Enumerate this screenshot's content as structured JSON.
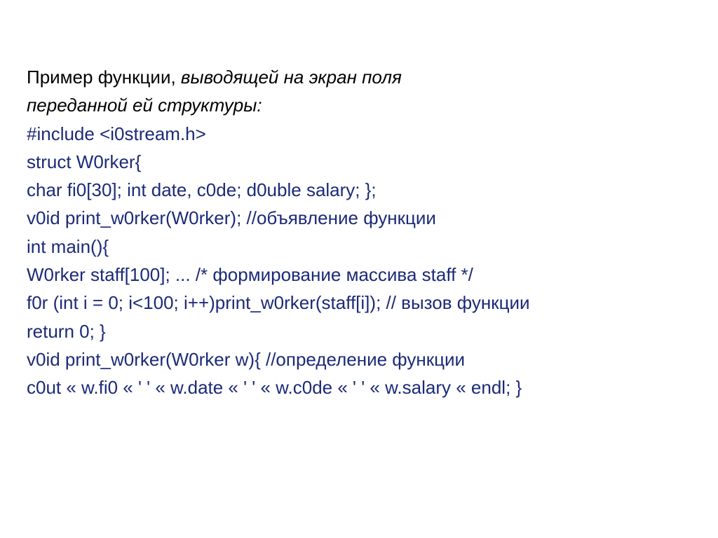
{
  "heading": {
    "plain": "Пример функции, ",
    "italic1": "выводящей на экран поля",
    "italic2": "переданной ей структуры:"
  },
  "code": {
    "l1": "#include <і0stream.h>",
    "l2": "struct W0rker{",
    "l3": "char fі0[30]; int date, c0de; d0uble salary; };",
    "l4": "v0id print_w0rker(W0rker); //объявление функции",
    "l5": "int main(){",
    "l6": "W0rker staff[100]; ... /* формирование массива staff */",
    "l7": "f0r (int i = 0; i<100; i++)print_w0rker(staff[i]); // вызов функции",
    "l8": "return 0; }",
    "l9": "v0id print_w0rker(W0rker w){ //определение функции",
    "l10": "c0ut « w.fі0 « ' ' « w.date « ' ' « w.c0de « ' ' « w.salary « endl; }"
  }
}
